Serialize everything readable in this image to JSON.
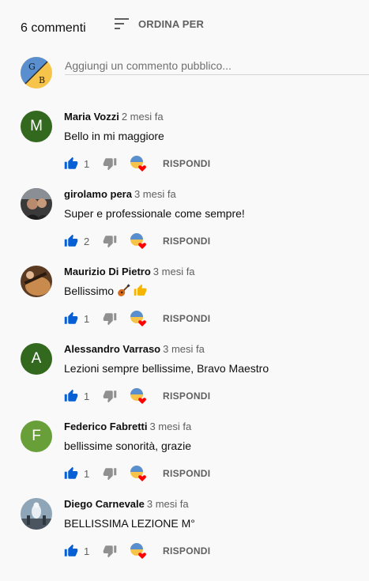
{
  "header": {
    "count": "6 commenti",
    "sort_label": "ORDINA PER"
  },
  "add_comment": {
    "placeholder": "Aggiungi un commento pubblico...",
    "channel_initials": [
      "G",
      "B"
    ]
  },
  "colors": {
    "like_blue": "#065fd4",
    "heart_red": "#ff0000",
    "avatar_green_dark": "#33691e",
    "avatar_green_light": "#689f38"
  },
  "reply_label": "RISPONDI",
  "comments": [
    {
      "author": "Maria Vozzi",
      "time": "2 mesi fa",
      "text": "Bello in mi maggiore",
      "likes": "1",
      "avatar_letter": "M"
    },
    {
      "author": "girolamo pera",
      "time": "3 mesi fa",
      "text": "Super e professionale come sempre!",
      "likes": "2",
      "avatar_letter": ""
    },
    {
      "author": "Maurizio Di Pietro",
      "time": "3 mesi fa",
      "text": "Bellissimo",
      "text_emojis": [
        "guitar",
        "thumbs-up"
      ],
      "likes": "1",
      "avatar_letter": ""
    },
    {
      "author": "Alessandro Varraso",
      "time": "3 mesi fa",
      "text": "Lezioni sempre bellissime, Bravo Maestro",
      "likes": "1",
      "avatar_letter": "A"
    },
    {
      "author": "Federico Fabretti",
      "time": "3 mesi fa",
      "text": "bellissime sonorità, grazie",
      "likes": "1",
      "avatar_letter": "F"
    },
    {
      "author": "Diego Carnevale",
      "time": "3 mesi fa",
      "text": "BELLISSIMA LEZIONE M°",
      "likes": "1",
      "avatar_letter": ""
    }
  ]
}
